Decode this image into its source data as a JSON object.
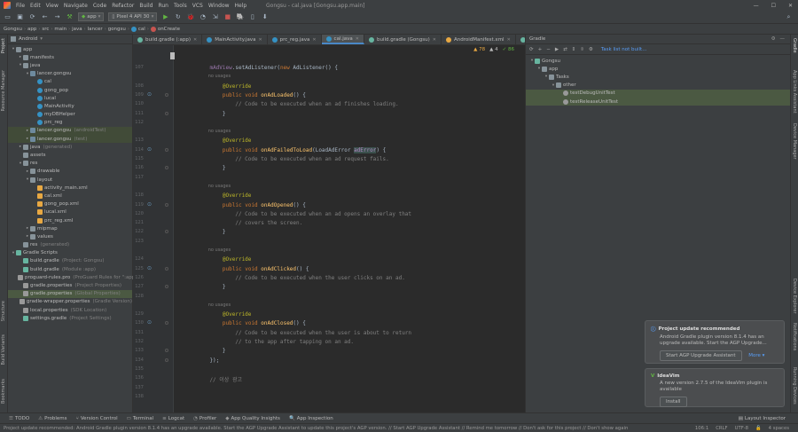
{
  "menu": {
    "items": [
      "File",
      "Edit",
      "View",
      "Navigate",
      "Code",
      "Refactor",
      "Build",
      "Run",
      "Tools",
      "VCS",
      "Window",
      "Help"
    ],
    "title": "Gongsu - cal.java [Gongsu.app.main]"
  },
  "toolbar": {
    "config": "app",
    "device": "Pixel 4 API 30"
  },
  "breadcrumbs": [
    "Gongsu",
    "app",
    "src",
    "main",
    "java",
    "lancer",
    "gongsu",
    "cal",
    "onCreate"
  ],
  "project": {
    "view": "Android",
    "tree": [
      {
        "label": "app",
        "hint": "",
        "depth": 0,
        "arrow": "▾",
        "icon": "fold"
      },
      {
        "label": "manifests",
        "hint": "",
        "depth": 1,
        "arrow": "▸",
        "icon": "fold"
      },
      {
        "label": "java",
        "hint": "",
        "depth": 1,
        "arrow": "▾",
        "icon": "fold"
      },
      {
        "label": "lancer.gongsu",
        "hint": "",
        "depth": 2,
        "arrow": "▾",
        "icon": "pkg"
      },
      {
        "label": "cal",
        "hint": "",
        "depth": 3,
        "arrow": "",
        "icon": "cls"
      },
      {
        "label": "gong_pop",
        "hint": "",
        "depth": 3,
        "arrow": "",
        "icon": "cls"
      },
      {
        "label": "lucal",
        "hint": "",
        "depth": 3,
        "arrow": "",
        "icon": "cls"
      },
      {
        "label": "MainActivity",
        "hint": "",
        "depth": 3,
        "arrow": "",
        "icon": "cls"
      },
      {
        "label": "myDBHelper",
        "hint": "",
        "depth": 3,
        "arrow": "",
        "icon": "cls"
      },
      {
        "label": "prc_reg",
        "hint": "",
        "depth": 3,
        "arrow": "",
        "icon": "cls"
      },
      {
        "label": "lancer.gongsu",
        "hint": "(androidTest)",
        "depth": 2,
        "arrow": "▸",
        "icon": "pkg",
        "hl": true
      },
      {
        "label": "lancer.gongsu",
        "hint": "(test)",
        "depth": 2,
        "arrow": "▸",
        "icon": "pkg",
        "hl": true
      },
      {
        "label": "java",
        "hint": "(generated)",
        "depth": 1,
        "arrow": "▸",
        "icon": "fold"
      },
      {
        "label": "assets",
        "hint": "",
        "depth": 1,
        "arrow": "",
        "icon": "fold"
      },
      {
        "label": "res",
        "hint": "",
        "depth": 1,
        "arrow": "▾",
        "icon": "fold"
      },
      {
        "label": "drawable",
        "hint": "",
        "depth": 2,
        "arrow": "▸",
        "icon": "fold"
      },
      {
        "label": "layout",
        "hint": "",
        "depth": 2,
        "arrow": "▾",
        "icon": "fold"
      },
      {
        "label": "activity_main.xml",
        "hint": "",
        "depth": 3,
        "arrow": "",
        "icon": "xml"
      },
      {
        "label": "cal.xml",
        "hint": "",
        "depth": 3,
        "arrow": "",
        "icon": "xml"
      },
      {
        "label": "gong_pop.xml",
        "hint": "",
        "depth": 3,
        "arrow": "",
        "icon": "xml"
      },
      {
        "label": "lucal.xml",
        "hint": "",
        "depth": 3,
        "arrow": "",
        "icon": "xml"
      },
      {
        "label": "prc_reg.xml",
        "hint": "",
        "depth": 3,
        "arrow": "",
        "icon": "xml"
      },
      {
        "label": "mipmap",
        "hint": "",
        "depth": 2,
        "arrow": "▸",
        "icon": "fold"
      },
      {
        "label": "values",
        "hint": "",
        "depth": 2,
        "arrow": "▸",
        "icon": "fold"
      },
      {
        "label": "res",
        "hint": "(generated)",
        "depth": 1,
        "arrow": "",
        "icon": "fold"
      },
      {
        "label": "Gradle Scripts",
        "hint": "",
        "depth": 0,
        "arrow": "▾",
        "icon": "grd"
      },
      {
        "label": "build.gradle",
        "hint": "(Project: Gongsu)",
        "depth": 1,
        "arrow": "",
        "icon": "grd"
      },
      {
        "label": "build.gradle",
        "hint": "(Module :app)",
        "depth": 1,
        "arrow": "",
        "icon": "grd"
      },
      {
        "label": "proguard-rules.pro",
        "hint": "(ProGuard Rules for \":app\")",
        "depth": 1,
        "arrow": "",
        "icon": "prop"
      },
      {
        "label": "gradle.properties",
        "hint": "(Project Properties)",
        "depth": 1,
        "arrow": "",
        "icon": "prop"
      },
      {
        "label": "gradle.properties",
        "hint": "(Global Properties)",
        "depth": 1,
        "arrow": "",
        "icon": "prop",
        "sel": true
      },
      {
        "label": "gradle-wrapper.properties",
        "hint": "(Gradle Version)",
        "depth": 1,
        "arrow": "",
        "icon": "prop"
      },
      {
        "label": "local.properties",
        "hint": "(SDK Location)",
        "depth": 1,
        "arrow": "",
        "icon": "prop"
      },
      {
        "label": "settings.gradle",
        "hint": "(Project Settings)",
        "depth": 1,
        "arrow": "",
        "icon": "grd"
      }
    ]
  },
  "left_strip": [
    "Project",
    "Resource Manager",
    "Structure",
    "Build Variants",
    "Bookmarks"
  ],
  "right_strip": [
    "Gradle",
    "App Links Assistant",
    "Device Manager",
    "Device Explorer",
    "Notifications",
    "Running Devices"
  ],
  "tabs": [
    {
      "label": "build.gradle (:app)",
      "active": false
    },
    {
      "label": "MainActivity.java",
      "active": false
    },
    {
      "label": "prc_reg.java",
      "active": false
    },
    {
      "label": "cal.java",
      "active": true
    },
    {
      "label": "build.gradle (Gongsu)",
      "active": false
    },
    {
      "label": "AndroidManifest.xml",
      "active": false
    },
    {
      "label": "gradle",
      "active": false
    }
  ],
  "inspections": {
    "warnings": "▲ 78",
    "weak": "▲ 4",
    "typos": "✓ 86"
  },
  "code_lines": [
    {
      "n": "107",
      "t": "    mAdView.setAdListener(new AdListener() {"
    },
    {
      "n": "",
      "t": "        no usages",
      "cls": "ul"
    },
    {
      "n": "108",
      "t": "        @Override",
      "cls": "an"
    },
    {
      "n": "109",
      "t": "        public void onAdLoaded() {",
      "mk": true
    },
    {
      "n": "110",
      "t": "            // Code to be executed when an ad finishes loading.",
      "cls": "cm"
    },
    {
      "n": "111",
      "t": "        }"
    },
    {
      "n": "112",
      "t": ""
    },
    {
      "n": "",
      "t": "        no usages",
      "cls": "ul"
    },
    {
      "n": "113",
      "t": "        @Override",
      "cls": "an"
    },
    {
      "n": "114",
      "t": "        public void onAdFailedToLoad(LoadAdError adError) {",
      "mk": true
    },
    {
      "n": "115",
      "t": "            // Code to be executed when an ad request fails.",
      "cls": "cm"
    },
    {
      "n": "116",
      "t": "        }"
    },
    {
      "n": "117",
      "t": ""
    },
    {
      "n": "",
      "t": "        no usages",
      "cls": "ul"
    },
    {
      "n": "118",
      "t": "        @Override",
      "cls": "an"
    },
    {
      "n": "119",
      "t": "        public void onAdOpened() {",
      "mk": true
    },
    {
      "n": "120",
      "t": "            // Code to be executed when an ad opens an overlay that",
      "cls": "cm"
    },
    {
      "n": "121",
      "t": "            // covers the screen.",
      "cls": "cm"
    },
    {
      "n": "122",
      "t": "        }"
    },
    {
      "n": "123",
      "t": ""
    },
    {
      "n": "",
      "t": "        no usages",
      "cls": "ul"
    },
    {
      "n": "124",
      "t": "        @Override",
      "cls": "an"
    },
    {
      "n": "125",
      "t": "        public void onAdClicked() {",
      "mk": true
    },
    {
      "n": "126",
      "t": "            // Code to be executed when the user clicks on an ad.",
      "cls": "cm"
    },
    {
      "n": "127",
      "t": "        }"
    },
    {
      "n": "128",
      "t": ""
    },
    {
      "n": "",
      "t": "        no usages",
      "cls": "ul"
    },
    {
      "n": "129",
      "t": "        @Override",
      "cls": "an"
    },
    {
      "n": "130",
      "t": "        public void onAdClosed() {",
      "mk": true
    },
    {
      "n": "131",
      "t": "            // Code to be executed when the user is about to return",
      "cls": "cm"
    },
    {
      "n": "132",
      "t": "            // to the app after tapping on an ad.",
      "cls": "cm"
    },
    {
      "n": "133",
      "t": "        }"
    },
    {
      "n": "134",
      "t": "    });"
    },
    {
      "n": "135",
      "t": ""
    },
    {
      "n": "136",
      "t": "    // 이상 광고",
      "cls": "cm"
    },
    {
      "n": "137",
      "t": ""
    },
    {
      "n": "138",
      "t": ""
    }
  ],
  "gradle": {
    "title": "Gradle",
    "task_link": "Task list not built...",
    "tree": [
      {
        "label": "Gongsu",
        "depth": 0,
        "arrow": "▾"
      },
      {
        "label": "app",
        "depth": 1,
        "arrow": "▾"
      },
      {
        "label": "Tasks",
        "depth": 2,
        "arrow": "▾"
      },
      {
        "label": "other",
        "depth": 3,
        "arrow": "▾"
      },
      {
        "label": "testDebugUnitTest",
        "depth": 4,
        "arrow": "",
        "sel": true
      },
      {
        "label": "testReleaseUnitTest",
        "depth": 4,
        "arrow": "",
        "sel": true
      }
    ]
  },
  "notifications": [
    {
      "title": "Project update recommended",
      "body": "Android Gradle plugin version 8.1.4 has an upgrade available. Start the AGP Upgrade...",
      "button": "Start AGP Upgrade Assistant",
      "link": "More ▾"
    },
    {
      "title": "IdeaVim",
      "body": "A new version 2.7.5 of the IdeaVim plugin is available",
      "button": "Install",
      "link": ""
    }
  ],
  "bottom_tabs": [
    "TODO",
    "Problems",
    "Version Control",
    "Terminal",
    "Logcat",
    "Profiler",
    "App Quality Insights",
    "App Inspection"
  ],
  "bottom_right": "Layout Inspector",
  "status": {
    "message": "Project update recommended: Android Gradle plugin version 8.1.4 has an upgrade available. Start the AGP Upgrade Assistant to update this project's AGP version. // Start AGP Upgrade Assistant // Remind me tomorrow // Don't ask for this project // Don't show again",
    "pos": "106:1",
    "eol": "CRLF",
    "enc": "UTF-8",
    "indent": "4 spaces"
  }
}
